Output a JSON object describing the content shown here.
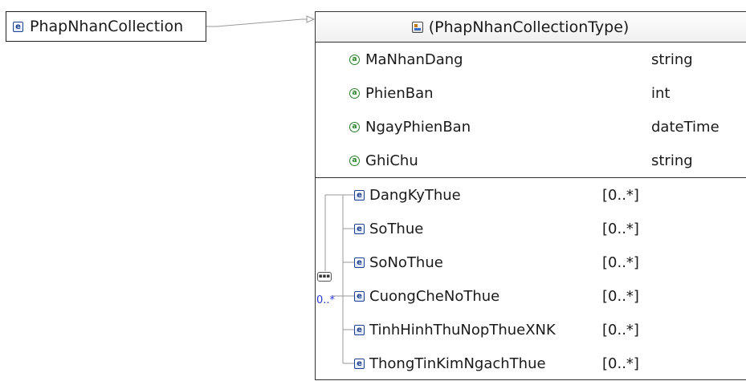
{
  "root_element": {
    "label": "PhapNhanCollection",
    "icon": "element-icon"
  },
  "complex_type": {
    "label": "(PhapNhanCollectionType)",
    "icon": "complex-type-icon"
  },
  "attributes": [
    {
      "name": "MaNhanDang",
      "type": "string",
      "icon": "attribute-icon"
    },
    {
      "name": "PhienBan",
      "type": "int",
      "icon": "attribute-icon"
    },
    {
      "name": "NgayPhienBan",
      "type": "dateTime",
      "icon": "attribute-icon"
    },
    {
      "name": "GhiChu",
      "type": "string",
      "icon": "attribute-icon"
    }
  ],
  "sequence": {
    "compositor_icon": "sequence-icon",
    "compositor_glyph": "▪▪▪",
    "occurrence": "0..*",
    "children": [
      {
        "name": "DangKyThue",
        "occurrence": "[0..*]",
        "icon": "element-icon"
      },
      {
        "name": "SoThue",
        "occurrence": "[0..*]",
        "icon": "element-icon"
      },
      {
        "name": "SoNoThue",
        "occurrence": "[0..*]",
        "icon": "element-icon"
      },
      {
        "name": "CuongCheNoThue",
        "occurrence": "[0..*]",
        "icon": "element-icon"
      },
      {
        "name": "TinhHinhThuNopThueXNK",
        "occurrence": "[0..*]",
        "icon": "element-icon"
      },
      {
        "name": "ThongTinKimNgachThue",
        "occurrence": "[0..*]",
        "icon": "element-icon"
      }
    ]
  },
  "colors": {
    "element_icon": "#1f3f8f",
    "attribute_icon": "#2e7d2e",
    "occurrence_blue": "#2a36d8",
    "connector": "#9a9a9a",
    "border": "#333333"
  },
  "glyphs": {
    "element": "e",
    "attribute": "a"
  }
}
